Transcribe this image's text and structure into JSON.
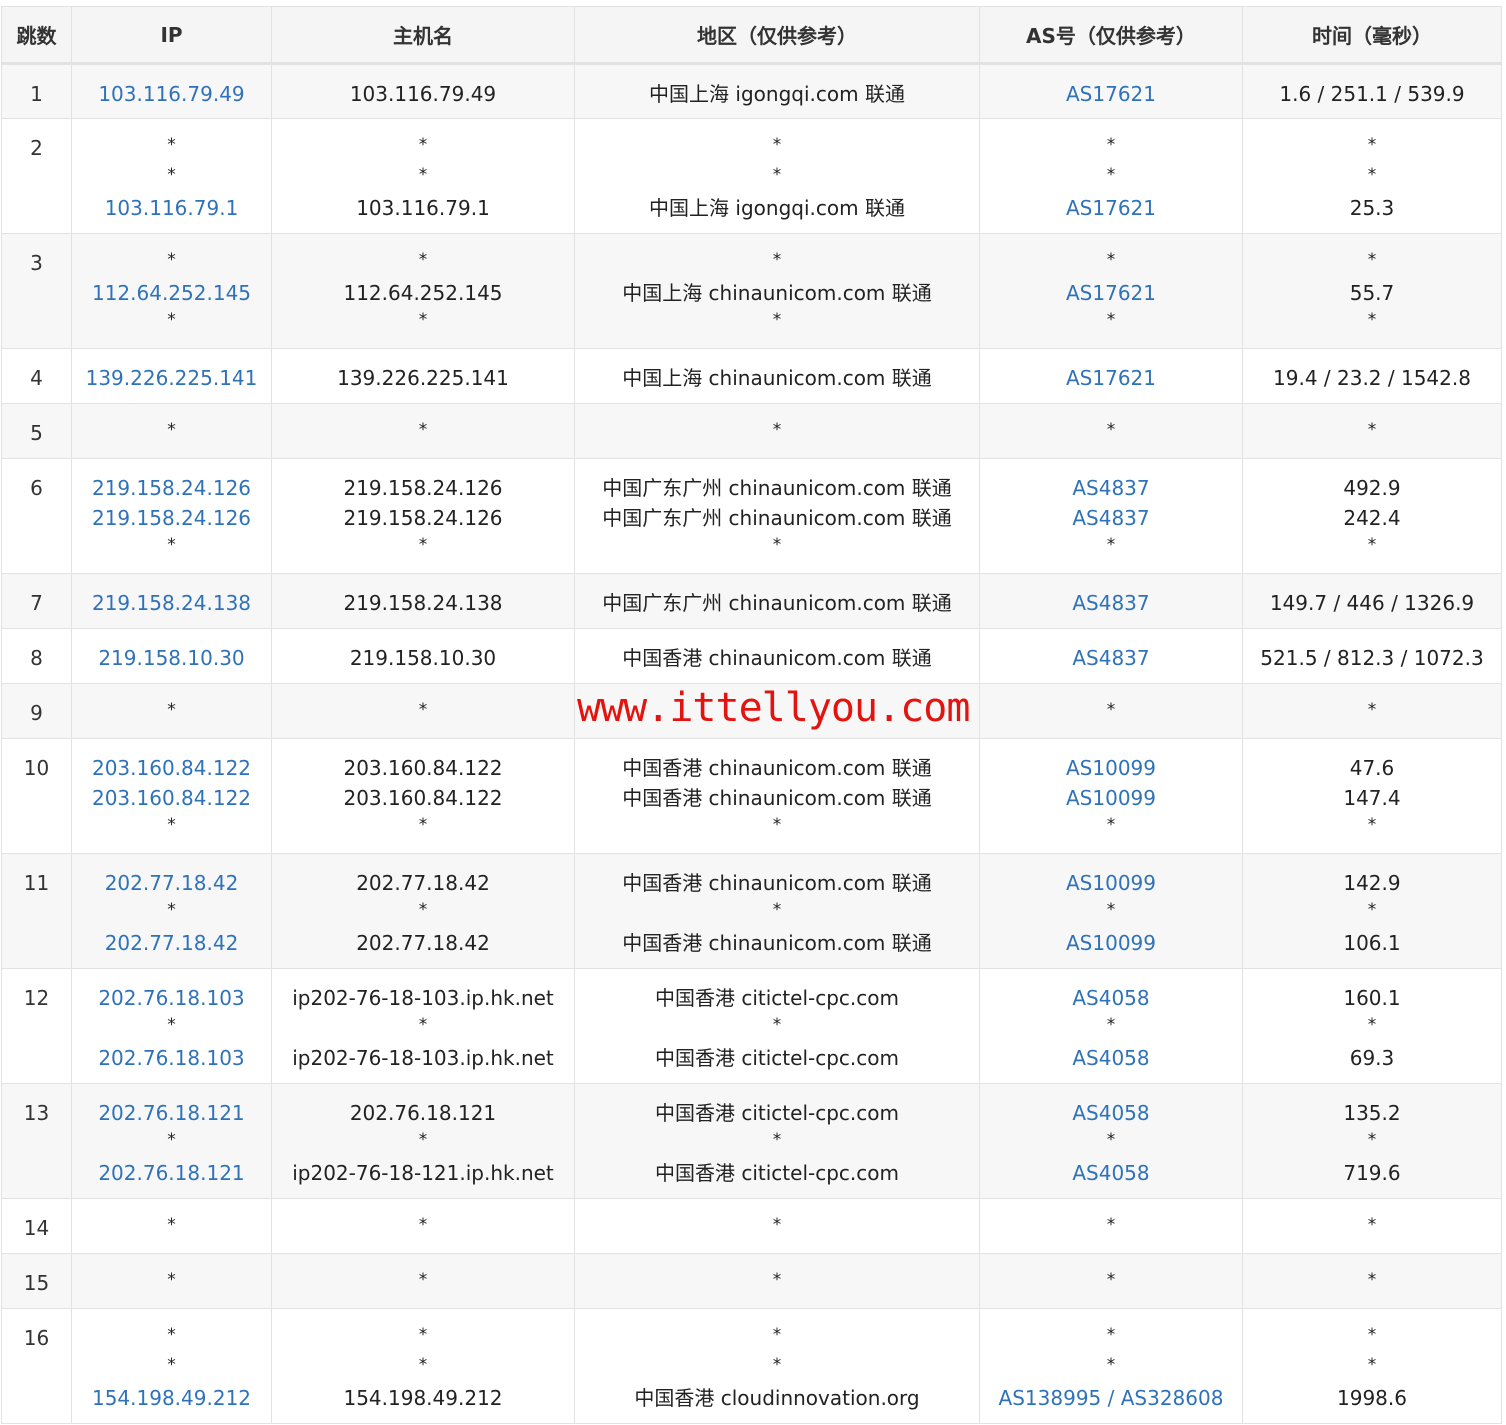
{
  "headers": [
    "跳数",
    "IP",
    "主机名",
    "地区（仅供参考）",
    "AS号（仅供参考）",
    "时间（毫秒）"
  ],
  "watermark": "www.ittellyou.com",
  "rows": [
    {
      "hop": "1",
      "ip": [
        "103.116.79.49"
      ],
      "host": [
        "103.116.79.49"
      ],
      "region": [
        "中国上海 igongqi.com 联通"
      ],
      "as": [
        "AS17621"
      ],
      "time": [
        "1.6 / 251.1 / 539.9"
      ]
    },
    {
      "hop": "2",
      "ip": [
        "*",
        "*",
        "103.116.79.1"
      ],
      "host": [
        "*",
        "*",
        "103.116.79.1"
      ],
      "region": [
        "*",
        "*",
        "中国上海 igongqi.com 联通"
      ],
      "as": [
        "*",
        "*",
        "AS17621"
      ],
      "time": [
        "*",
        "*",
        "25.3"
      ]
    },
    {
      "hop": "3",
      "ip": [
        "*",
        "112.64.252.145",
        "*"
      ],
      "host": [
        "*",
        "112.64.252.145",
        "*"
      ],
      "region": [
        "*",
        "中国上海 chinaunicom.com 联通",
        "*"
      ],
      "as": [
        "*",
        "AS17621",
        "*"
      ],
      "time": [
        "*",
        "55.7",
        "*"
      ]
    },
    {
      "hop": "4",
      "ip": [
        "139.226.225.141"
      ],
      "host": [
        "139.226.225.141"
      ],
      "region": [
        "中国上海 chinaunicom.com 联通"
      ],
      "as": [
        "AS17621"
      ],
      "time": [
        "19.4 / 23.2 / 1542.8"
      ]
    },
    {
      "hop": "5",
      "ip": [
        "*"
      ],
      "host": [
        "*"
      ],
      "region": [
        "*"
      ],
      "as": [
        "*"
      ],
      "time": [
        "*"
      ]
    },
    {
      "hop": "6",
      "ip": [
        "219.158.24.126",
        "219.158.24.126",
        "*"
      ],
      "host": [
        "219.158.24.126",
        "219.158.24.126",
        "*"
      ],
      "region": [
        "中国广东广州 chinaunicom.com 联通",
        "中国广东广州 chinaunicom.com 联通",
        "*"
      ],
      "as": [
        "AS4837",
        "AS4837",
        "*"
      ],
      "time": [
        "492.9",
        "242.4",
        "*"
      ]
    },
    {
      "hop": "7",
      "ip": [
        "219.158.24.138"
      ],
      "host": [
        "219.158.24.138"
      ],
      "region": [
        "中国广东广州 chinaunicom.com 联通"
      ],
      "as": [
        "AS4837"
      ],
      "time": [
        "149.7 / 446 / 1326.9"
      ]
    },
    {
      "hop": "8",
      "ip": [
        "219.158.10.30"
      ],
      "host": [
        "219.158.10.30"
      ],
      "region": [
        "中国香港 chinaunicom.com 联通"
      ],
      "as": [
        "AS4837"
      ],
      "time": [
        "521.5 / 812.3 / 1072.3"
      ]
    },
    {
      "hop": "9",
      "ip": [
        "*"
      ],
      "host": [
        "*"
      ],
      "region": [
        ""
      ],
      "as": [
        "*"
      ],
      "time": [
        "*"
      ]
    },
    {
      "hop": "10",
      "ip": [
        "203.160.84.122",
        "203.160.84.122",
        "*"
      ],
      "host": [
        "203.160.84.122",
        "203.160.84.122",
        "*"
      ],
      "region": [
        "中国香港 chinaunicom.com 联通",
        "中国香港 chinaunicom.com 联通",
        "*"
      ],
      "as": [
        "AS10099",
        "AS10099",
        "*"
      ],
      "time": [
        "47.6",
        "147.4",
        "*"
      ]
    },
    {
      "hop": "11",
      "ip": [
        "202.77.18.42",
        "*",
        "202.77.18.42"
      ],
      "host": [
        "202.77.18.42",
        "*",
        "202.77.18.42"
      ],
      "region": [
        "中国香港 chinaunicom.com 联通",
        "*",
        "中国香港 chinaunicom.com 联通"
      ],
      "as": [
        "AS10099",
        "*",
        "AS10099"
      ],
      "time": [
        "142.9",
        "*",
        "106.1"
      ]
    },
    {
      "hop": "12",
      "ip": [
        "202.76.18.103",
        "*",
        "202.76.18.103"
      ],
      "host": [
        "ip202-76-18-103.ip.hk.net",
        "*",
        "ip202-76-18-103.ip.hk.net"
      ],
      "region": [
        "中国香港 citictel-cpc.com",
        "*",
        "中国香港 citictel-cpc.com"
      ],
      "as": [
        "AS4058",
        "*",
        "AS4058"
      ],
      "time": [
        "160.1",
        "*",
        "69.3"
      ]
    },
    {
      "hop": "13",
      "ip": [
        "202.76.18.121",
        "*",
        "202.76.18.121"
      ],
      "host": [
        "202.76.18.121",
        "*",
        "ip202-76-18-121.ip.hk.net"
      ],
      "region": [
        "中国香港 citictel-cpc.com",
        "*",
        "中国香港 citictel-cpc.com"
      ],
      "as": [
        "AS4058",
        "*",
        "AS4058"
      ],
      "time": [
        "135.2",
        "*",
        "719.6"
      ]
    },
    {
      "hop": "14",
      "ip": [
        "*"
      ],
      "host": [
        "*"
      ],
      "region": [
        "*"
      ],
      "as": [
        "*"
      ],
      "time": [
        "*"
      ]
    },
    {
      "hop": "15",
      "ip": [
        "*"
      ],
      "host": [
        "*"
      ],
      "region": [
        "*"
      ],
      "as": [
        "*"
      ],
      "time": [
        "*"
      ]
    },
    {
      "hop": "16",
      "ip": [
        "*",
        "*",
        "154.198.49.212"
      ],
      "host": [
        "*",
        "*",
        "154.198.49.212"
      ],
      "region": [
        "*",
        "*",
        "中国香港 cloudinnovation.org"
      ],
      "as": [
        "*",
        "*",
        "AS138995 / AS328608"
      ],
      "time": [
        "*",
        "*",
        "1998.6"
      ]
    }
  ]
}
